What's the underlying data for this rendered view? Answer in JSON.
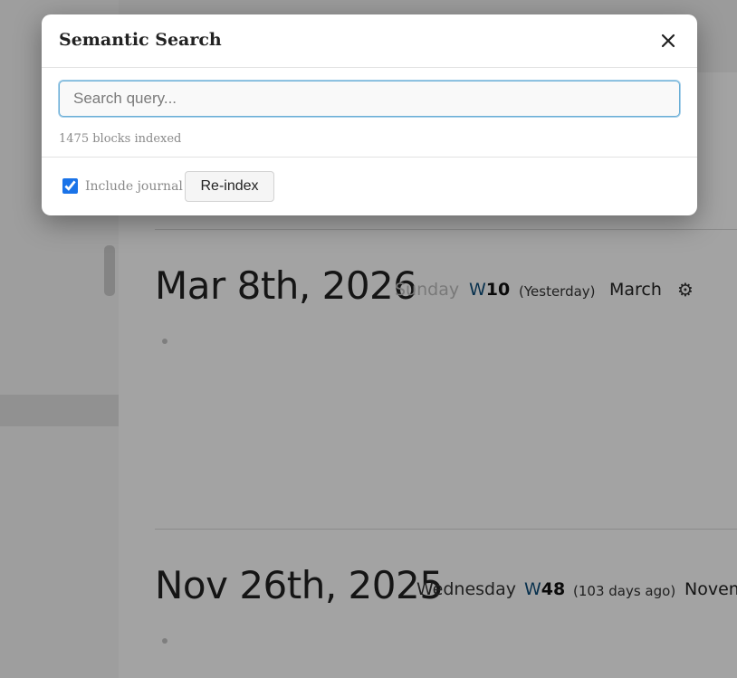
{
  "modal": {
    "title": "Semantic Search",
    "close_icon": "close-icon",
    "search": {
      "placeholder": "Search query...",
      "value": ""
    },
    "index_status": "1475 blocks indexed",
    "include_journal": {
      "label": "Include journal",
      "checked": true
    },
    "reindex_label": "Re-index",
    "accent_color": "#1a73e8"
  },
  "journals": [
    {
      "date": "Mar 8th, 2026",
      "weekday": "Sunday",
      "week_prefix": "W",
      "week_number": "10",
      "relative": "(Yesterday)",
      "month": "March",
      "settings_icon": "gear-icon"
    },
    {
      "date": "Nov 26th, 2025",
      "weekday": "Wednesday",
      "week_prefix": "W",
      "week_number": "48",
      "relative": "(103 days ago)",
      "month": "Novem"
    }
  ]
}
